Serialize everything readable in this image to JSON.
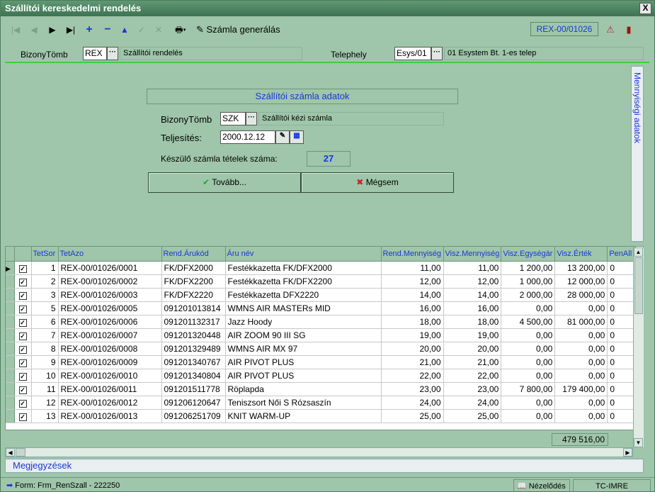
{
  "window": {
    "title": "Szállítói kereskedelmi rendelés",
    "close": "X"
  },
  "toolbar": {
    "first": "|◀",
    "prev": "◀",
    "next": "▶",
    "last": "▶|",
    "add": "+",
    "remove": "−",
    "up": "▲",
    "check": "✓",
    "cancel": "✕",
    "print": "🖶▾",
    "generate_label": "Számla generálás",
    "record_id": "REX-00/01026",
    "help": "⚠",
    "exit": "▮"
  },
  "header": {
    "bizonytomb_label": "BizonyTömb",
    "bizonytomb_value": "REX",
    "bizonytomb_desc": "Szállítói rendelés",
    "telephely_label": "Telephely",
    "telephely_value": "Esys/01",
    "telephely_desc": "01 Esystem Bt. 1-es telep",
    "dots": "···"
  },
  "panel": {
    "title": "Szállítói számla adatok",
    "bizonytomb_label": "BizonyTömb",
    "bizonytomb_value": "SZK",
    "bizonytomb_desc": "Szállítói kézi számla",
    "teljesites_label": "Teljesítés:",
    "teljesites_value": "2000.12.12",
    "count_label": "Készülő számla tételek száma:",
    "count_value": "27",
    "ok_label": "Tovább...",
    "ok_icon": "✔",
    "cancel_label": "Mégsem",
    "cancel_icon": "✖",
    "side_tab": "Mennyiségi adatok"
  },
  "grid": {
    "columns": [
      "TetSor",
      "TetAzo",
      "Rend.Árukód",
      "Áru név",
      "Rend.Mennyiség",
      "Visz.Mennyiség",
      "Visz.Egységár",
      "Visz.Érték",
      "PenAll"
    ],
    "rows": [
      {
        "sor": "1",
        "azo": "REX-00/01026/0001",
        "kod": "FK/DFX2000",
        "nev": "Festékkazetta FK/DFX2000",
        "rend": "11,00",
        "visz": "11,00",
        "ar": "1 200,00",
        "ertek": "13 200,00",
        "pen": "0"
      },
      {
        "sor": "2",
        "azo": "REX-00/01026/0002",
        "kod": "FK/DFX2200",
        "nev": "Festékkazetta FK/DFX2200",
        "rend": "12,00",
        "visz": "12,00",
        "ar": "1 000,00",
        "ertek": "12 000,00",
        "pen": "0"
      },
      {
        "sor": "3",
        "azo": "REX-00/01026/0003",
        "kod": "FK/DFX2220",
        "nev": "Festékkazetta DFX2220",
        "rend": "14,00",
        "visz": "14,00",
        "ar": "2 000,00",
        "ertek": "28 000,00",
        "pen": "0"
      },
      {
        "sor": "5",
        "azo": "REX-00/01026/0005",
        "kod": "091201013814",
        "nev": "WMNS AIR MASTERs MID",
        "rend": "16,00",
        "visz": "16,00",
        "ar": "0,00",
        "ertek": "0,00",
        "pen": "0"
      },
      {
        "sor": "6",
        "azo": "REX-00/01026/0006",
        "kod": "091201132317",
        "nev": "Jazz Hoody",
        "rend": "18,00",
        "visz": "18,00",
        "ar": "4 500,00",
        "ertek": "81 000,00",
        "pen": "0"
      },
      {
        "sor": "7",
        "azo": "REX-00/01026/0007",
        "kod": "091201320448",
        "nev": "AIR ZOOM 90 III SG",
        "rend": "19,00",
        "visz": "19,00",
        "ar": "0,00",
        "ertek": "0,00",
        "pen": "0"
      },
      {
        "sor": "8",
        "azo": "REX-00/01026/0008",
        "kod": "091201329489",
        "nev": "WMNS AIR MX 97",
        "rend": "20,00",
        "visz": "20,00",
        "ar": "0,00",
        "ertek": "0,00",
        "pen": "0"
      },
      {
        "sor": "9",
        "azo": "REX-00/01026/0009",
        "kod": "091201340767",
        "nev": "AIR PIVOT PLUS",
        "rend": "21,00",
        "visz": "21,00",
        "ar": "0,00",
        "ertek": "0,00",
        "pen": "0"
      },
      {
        "sor": "10",
        "azo": "REX-00/01026/0010",
        "kod": "091201340804",
        "nev": "AIR PIVOT PLUS",
        "rend": "22,00",
        "visz": "22,00",
        "ar": "0,00",
        "ertek": "0,00",
        "pen": "0"
      },
      {
        "sor": "11",
        "azo": "REX-00/01026/0011",
        "kod": "091201511778",
        "nev": "Röplapda",
        "rend": "23,00",
        "visz": "23,00",
        "ar": "7 800,00",
        "ertek": "179 400,00",
        "pen": "0"
      },
      {
        "sor": "12",
        "azo": "REX-00/01026/0012",
        "kod": "091206120647",
        "nev": "Teniszsort Női S Rózsaszín",
        "rend": "24,00",
        "visz": "24,00",
        "ar": "0,00",
        "ertek": "0,00",
        "pen": "0"
      },
      {
        "sor": "13",
        "azo": "REX-00/01026/0013",
        "kod": "091206251709",
        "nev": "KNIT WARM-UP",
        "rend": "25,00",
        "visz": "25,00",
        "ar": "0,00",
        "ertek": "0,00",
        "pen": "0"
      }
    ],
    "total": "479 516,00"
  },
  "notes_label": "Megjegyzések",
  "status": {
    "form": "Form: Frm_RenSzall - 222250",
    "mode": "Nézelődés",
    "user": "TC-IMRE"
  }
}
